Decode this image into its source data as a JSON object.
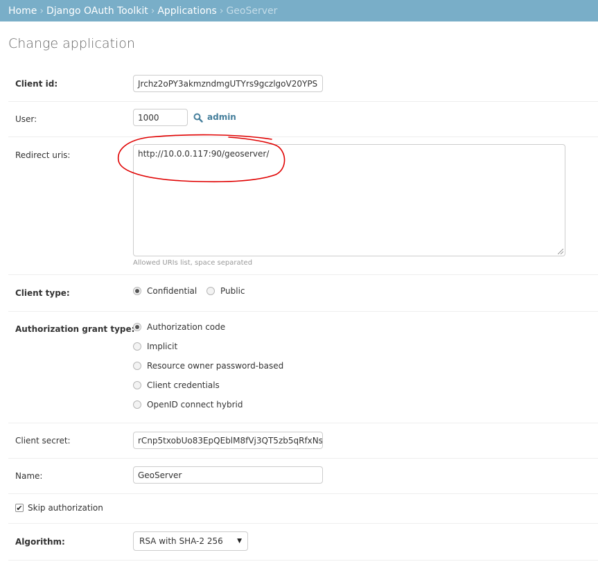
{
  "breadcrumbs": {
    "items": [
      "Home",
      "Django OAuth Toolkit",
      "Applications"
    ],
    "current": "GeoServer",
    "separator": "›"
  },
  "page_title": "Change application",
  "fields": {
    "client_id": {
      "label": "Client id:",
      "value": "Jrchz2oPY3akmzndmgUTYrs9gczlgoV20YPS"
    },
    "user": {
      "label": "User:",
      "value": "1000",
      "lookup_label": "admin"
    },
    "redirect_uris": {
      "label": "Redirect uris:",
      "value": "http://10.0.0.117:90/geoserver/",
      "help": "Allowed URIs list, space separated"
    },
    "client_type": {
      "label": "Client type:",
      "options": [
        {
          "label": "Confidential",
          "checked": true
        },
        {
          "label": "Public",
          "checked": false
        }
      ]
    },
    "grant_type": {
      "label": "Authorization grant type:",
      "options": [
        {
          "label": "Authorization code",
          "checked": true
        },
        {
          "label": "Implicit",
          "checked": false
        },
        {
          "label": "Resource owner password-based",
          "checked": false
        },
        {
          "label": "Client credentials",
          "checked": false
        },
        {
          "label": "OpenID connect hybrid",
          "checked": false
        }
      ]
    },
    "client_secret": {
      "label": "Client secret:",
      "value": "rCnp5txobUo83EpQEblM8fVj3QT5zb5qRfxNs"
    },
    "name": {
      "label": "Name:",
      "value": "GeoServer"
    },
    "skip_authorization": {
      "label": "Skip authorization",
      "checked": true
    },
    "algorithm": {
      "label": "Algorithm:",
      "value": "RSA with SHA-2 256"
    }
  },
  "colors": {
    "header_bg": "#79aec8",
    "link": "#447e9b",
    "annotation": "#e00000"
  },
  "icons": {
    "lookup": "search-icon",
    "dropdown": "chevron-down-icon",
    "checkbox": "checkmark-icon"
  }
}
